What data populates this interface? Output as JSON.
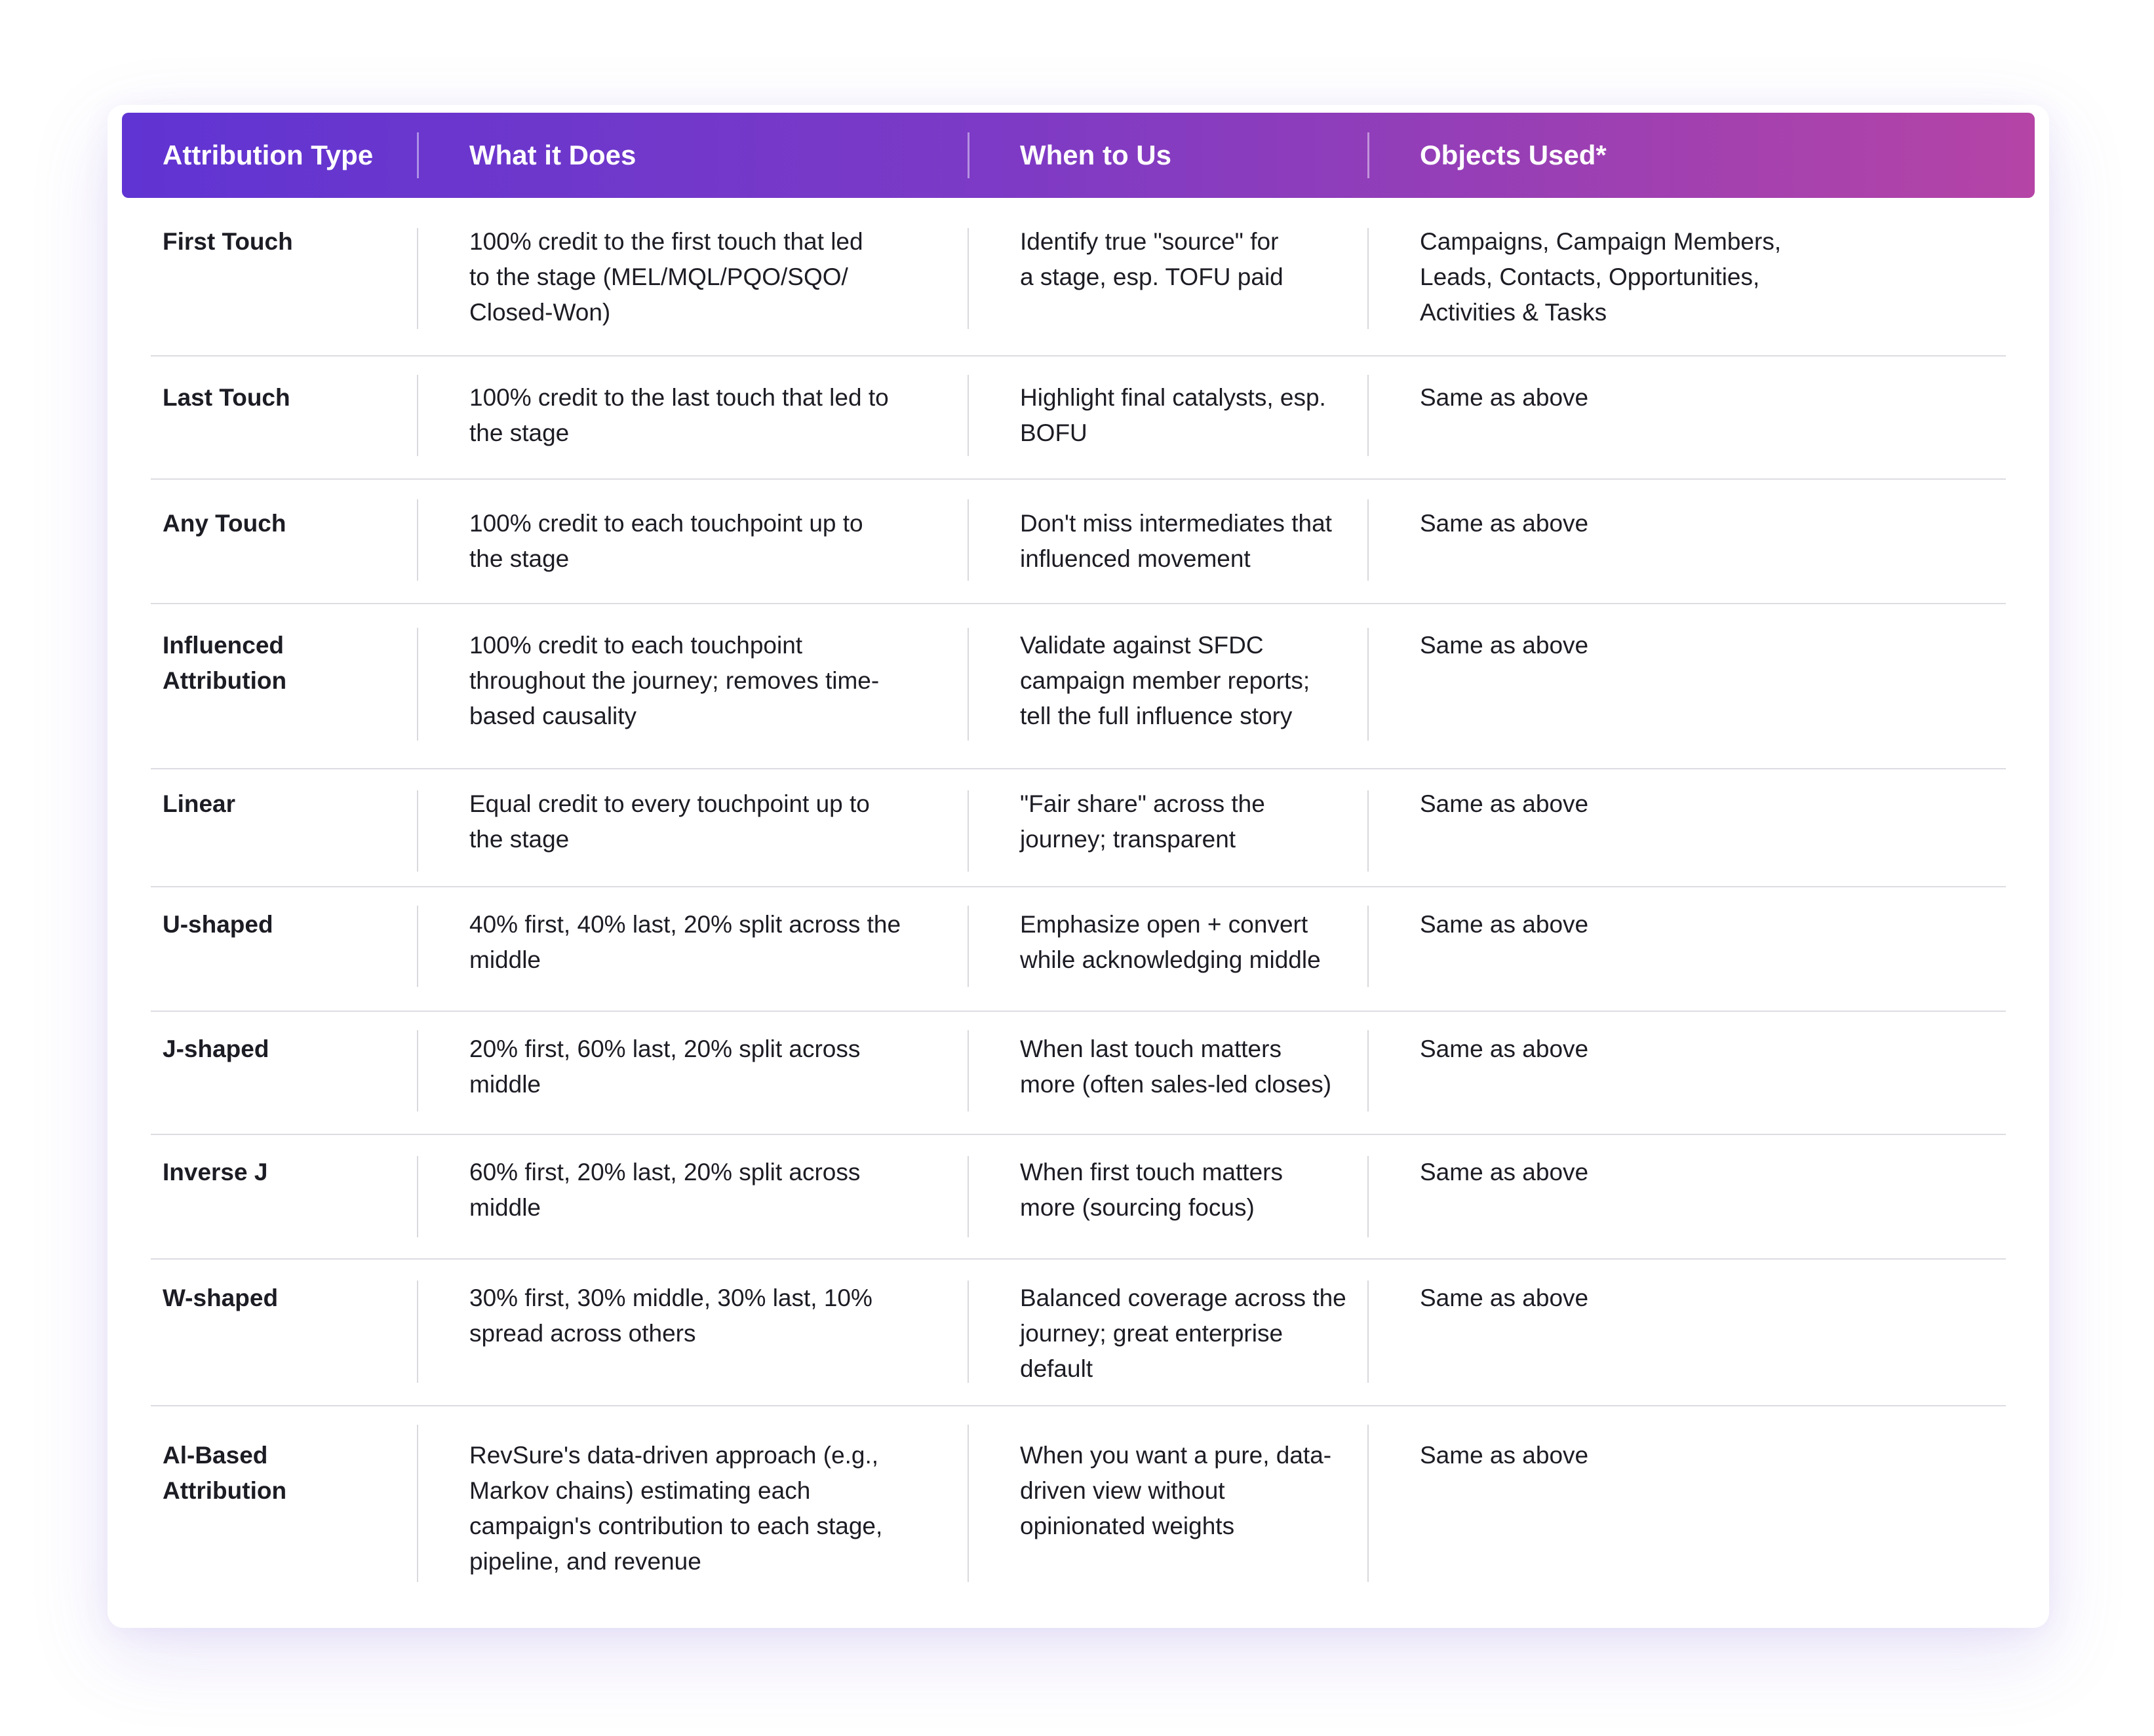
{
  "header": {
    "col1": "Attribution Type",
    "col2": "What it Does",
    "col3": "When to Us",
    "col4": "Objects Used*"
  },
  "rows": [
    {
      "type": "First Touch",
      "does": "100% credit to the first touch that led\nto the stage (MEL/MQL/PQO/SQO/\nClosed-Won)",
      "when": "Identify true \"source\" for\na stage, esp. TOFU paid",
      "objects": "Campaigns, Campaign Members,\nLeads, Contacts, Opportunities,\nActivities & Tasks"
    },
    {
      "type": "Last Touch",
      "does": "100% credit to the last touch that led to\nthe stage",
      "when": "Highlight final catalysts, esp.\nBOFU",
      "objects": "Same as above"
    },
    {
      "type": "Any Touch",
      "does": "100% credit to each touchpoint up to\nthe stage",
      "when": "Don't miss intermediates that\ninfluenced movement",
      "objects": "Same as above"
    },
    {
      "type": "Influenced\nAttribution",
      "does": "100% credit to each touchpoint\nthroughout the journey; removes time-\nbased causality",
      "when": "Validate against SFDC\ncampaign member reports;\ntell the full influence story",
      "objects": "Same as above"
    },
    {
      "type": "Linear",
      "does": "Equal credit to every touchpoint up to\nthe stage",
      "when": "\"Fair share\" across the\njourney; transparent",
      "objects": "Same as above"
    },
    {
      "type": "U-shaped",
      "does": "40% first, 40% last, 20% split across the\nmiddle",
      "when": "Emphasize open + convert\nwhile acknowledging middle",
      "objects": "Same as above"
    },
    {
      "type": "J-shaped",
      "does": "20% first, 60% last, 20% split across\nmiddle",
      "when": "When last touch matters\nmore (often sales-led closes)",
      "objects": "Same as above"
    },
    {
      "type": "Inverse J",
      "does": "60% first, 20% last, 20% split across\nmiddle",
      "when": "When first touch matters\nmore (sourcing focus)",
      "objects": "Same as above"
    },
    {
      "type": "W-shaped",
      "does": "30% first, 30% middle, 30% last, 10%\nspread across others",
      "when": "Balanced coverage across the\njourney; great enterprise\ndefault",
      "objects": "Same as above"
    },
    {
      "type": "Al-Based\nAttribution",
      "does": "RevSure's data-driven approach (e.g.,\nMarkov chains) estimating each\ncampaign's contribution to each stage,\npipeline, and revenue",
      "when": "When you want a pure, data-\ndriven view without\nopinionated weights",
      "objects": "Same as above"
    }
  ]
}
